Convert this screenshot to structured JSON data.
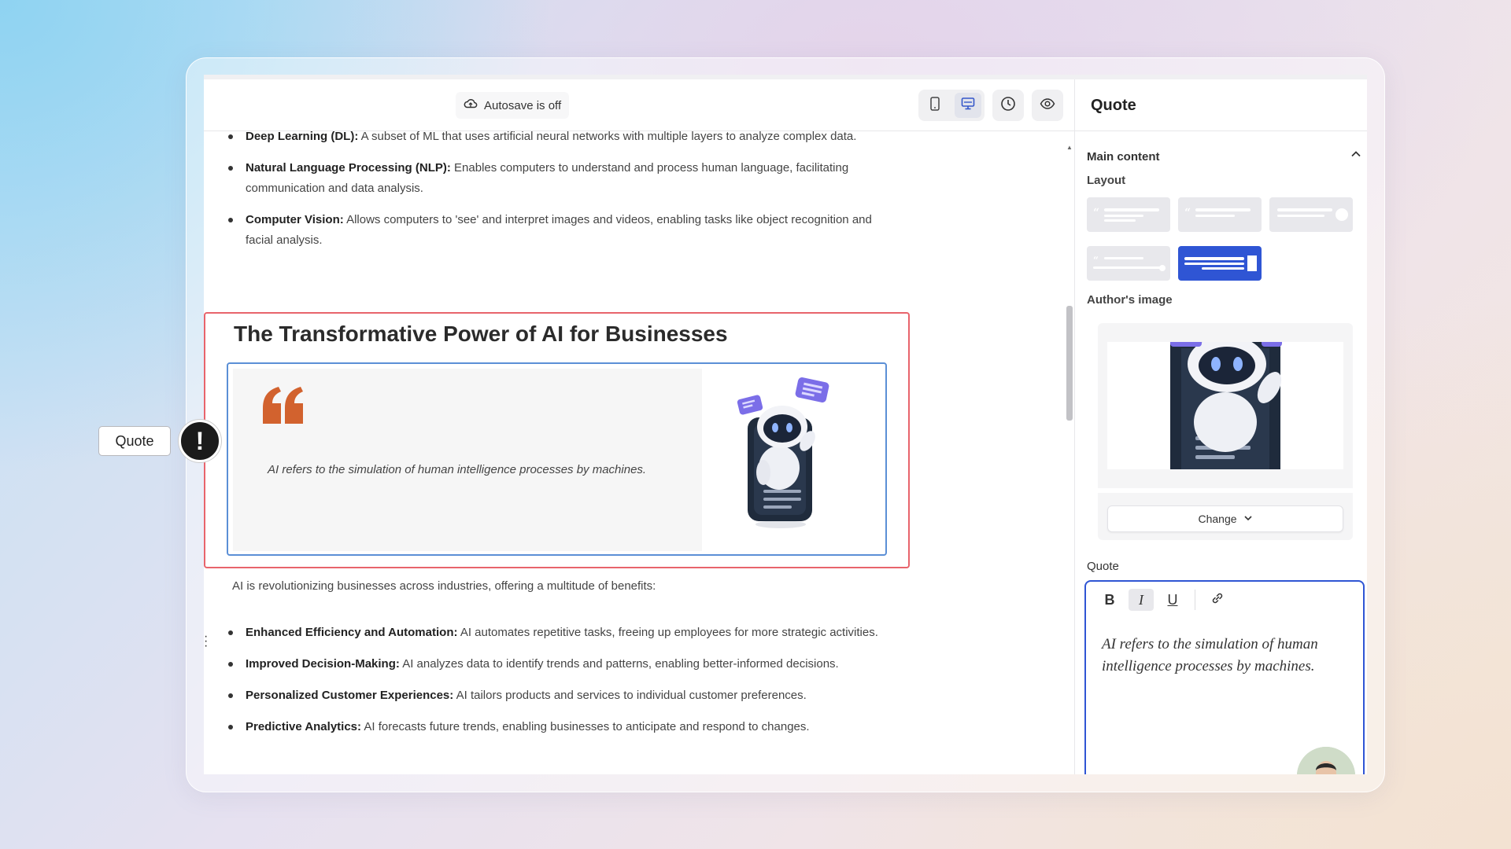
{
  "toolbar": {
    "autosave_label": "Autosave is off"
  },
  "article": {
    "top_bullets": [
      {
        "term": "Deep Learning (DL):",
        "text": " A subset of ML that uses artificial neural networks with multiple layers to analyze complex data."
      },
      {
        "term": "Natural Language Processing (NLP):",
        "text": " Enables computers to understand and process human language, facilitating communication and data analysis."
      },
      {
        "term": "Computer Vision:",
        "text": " Allows computers to 'see' and interpret images and videos, enabling tasks like object recognition and facial analysis."
      }
    ],
    "section_title": "The Transformative Power of AI for Businesses",
    "quote_text": "AI refers to the simulation of human intelligence processes by machines.",
    "intro_paragraph": "AI is revolutionizing businesses across industries, offering a multitude of benefits:",
    "benefit_bullets": [
      {
        "term": "Enhanced Efficiency and Automation:",
        "text": " AI automates repetitive tasks, freeing up employees for more strategic activities."
      },
      {
        "term": "Improved Decision-Making:",
        "text": " AI analyzes data to identify trends and patterns, enabling better-informed decisions."
      },
      {
        "term": "Personalized Customer Experiences:",
        "text": " AI tailors products and services to individual customer preferences."
      },
      {
        "term": "Predictive Analytics:",
        "text": " AI forecasts future trends, enabling businesses to anticipate and respond to changes."
      }
    ]
  },
  "sidebar": {
    "title": "Quote",
    "section_title": "Main content",
    "layout_label": "Layout",
    "selected_layout": 5,
    "author_image_label": "Author's image",
    "change_button": "Change",
    "quote_label": "Quote",
    "quote_value": "AI refers to the simulation of human intelligence processes by machines.",
    "format_buttons": [
      "bold",
      "italic",
      "underline",
      "link"
    ],
    "active_format": "italic"
  },
  "annotation": {
    "tag_label": "Quote",
    "badge_symbol": "!"
  },
  "colors": {
    "accent": "#2f55d4",
    "selection_border": "#e8646c",
    "quote_mark": "#d2622e",
    "robot_chat": "#7b6ee8"
  }
}
